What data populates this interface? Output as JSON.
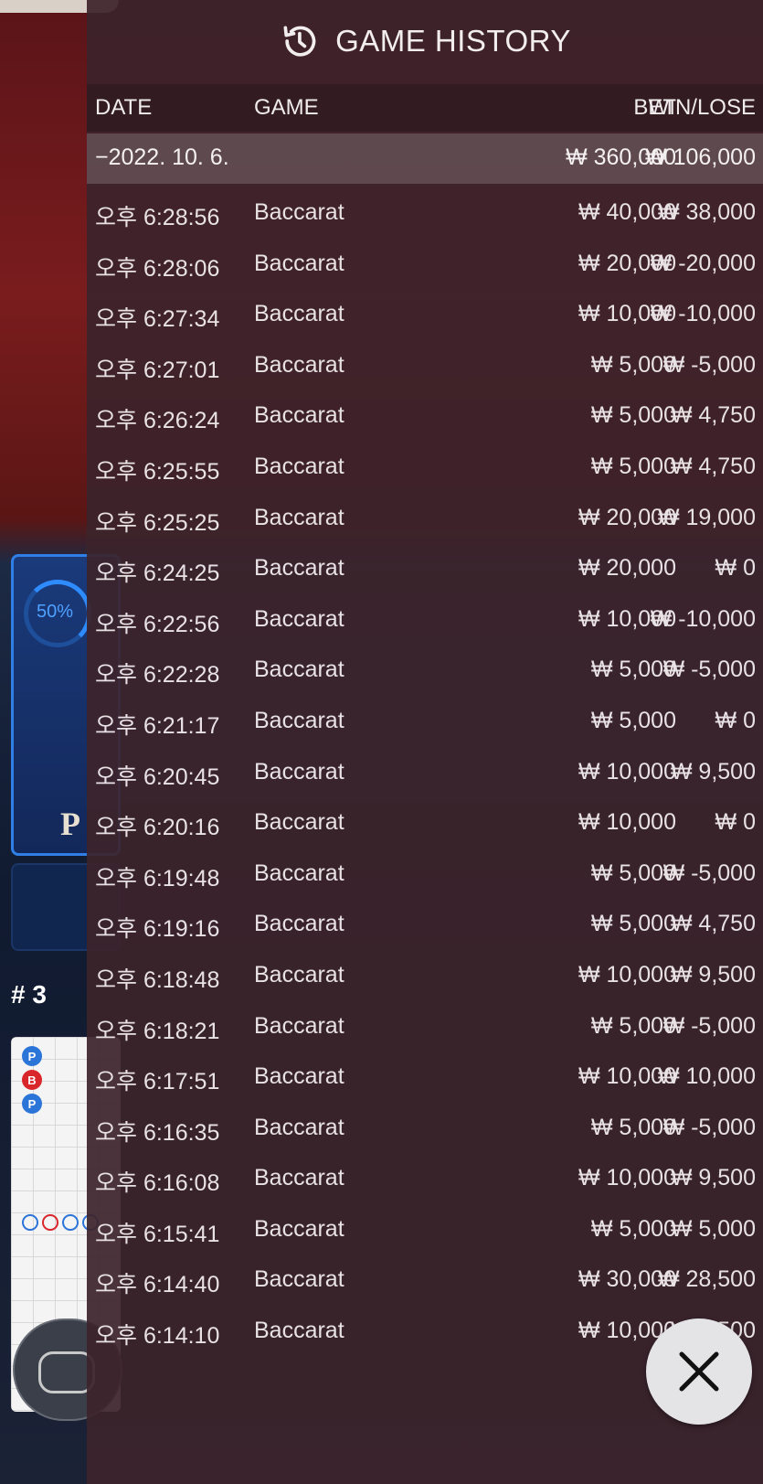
{
  "background": {
    "progress_label": "50%",
    "table_letter": "P",
    "table_number": "# 3",
    "beads": [
      "P",
      "B",
      "P"
    ]
  },
  "header": {
    "title": "GAME HISTORY",
    "icon": "history-icon"
  },
  "columns": {
    "date": "DATE",
    "game": "GAME",
    "bet": "BET",
    "win_lose": "WIN/LOSE"
  },
  "summary": {
    "date": "−2022. 10. 6.",
    "bet": "₩ 360,000",
    "win_lose": "₩ 106,000"
  },
  "rows": [
    {
      "time": "오후 6:28:56",
      "game": "Baccarat",
      "bet": "₩ 40,000",
      "win_lose": "₩ 38,000"
    },
    {
      "time": "오후 6:28:06",
      "game": "Baccarat",
      "bet": "₩ 20,000",
      "win_lose": "₩ -20,000"
    },
    {
      "time": "오후 6:27:34",
      "game": "Baccarat",
      "bet": "₩ 10,000",
      "win_lose": "₩ -10,000"
    },
    {
      "time": "오후 6:27:01",
      "game": "Baccarat",
      "bet": "₩ 5,000",
      "win_lose": "₩ -5,000"
    },
    {
      "time": "오후 6:26:24",
      "game": "Baccarat",
      "bet": "₩ 5,000",
      "win_lose": "₩ 4,750"
    },
    {
      "time": "오후 6:25:55",
      "game": "Baccarat",
      "bet": "₩ 5,000",
      "win_lose": "₩ 4,750"
    },
    {
      "time": "오후 6:25:25",
      "game": "Baccarat",
      "bet": "₩ 20,000",
      "win_lose": "₩ 19,000"
    },
    {
      "time": "오후 6:24:25",
      "game": "Baccarat",
      "bet": "₩ 20,000",
      "win_lose": "₩ 0"
    },
    {
      "time": "오후 6:22:56",
      "game": "Baccarat",
      "bet": "₩ 10,000",
      "win_lose": "₩ -10,000"
    },
    {
      "time": "오후 6:22:28",
      "game": "Baccarat",
      "bet": "₩ 5,000",
      "win_lose": "₩ -5,000"
    },
    {
      "time": "오후 6:21:17",
      "game": "Baccarat",
      "bet": "₩ 5,000",
      "win_lose": "₩ 0"
    },
    {
      "time": "오후 6:20:45",
      "game": "Baccarat",
      "bet": "₩ 10,000",
      "win_lose": "₩ 9,500"
    },
    {
      "time": "오후 6:20:16",
      "game": "Baccarat",
      "bet": "₩ 10,000",
      "win_lose": "₩ 0"
    },
    {
      "time": "오후 6:19:48",
      "game": "Baccarat",
      "bet": "₩ 5,000",
      "win_lose": "₩ -5,000"
    },
    {
      "time": "오후 6:19:16",
      "game": "Baccarat",
      "bet": "₩ 5,000",
      "win_lose": "₩ 4,750"
    },
    {
      "time": "오후 6:18:48",
      "game": "Baccarat",
      "bet": "₩ 10,000",
      "win_lose": "₩ 9,500"
    },
    {
      "time": "오후 6:18:21",
      "game": "Baccarat",
      "bet": "₩ 5,000",
      "win_lose": "₩ -5,000"
    },
    {
      "time": "오후 6:17:51",
      "game": "Baccarat",
      "bet": "₩ 10,000",
      "win_lose": "₩ 10,000"
    },
    {
      "time": "오후 6:16:35",
      "game": "Baccarat",
      "bet": "₩ 5,000",
      "win_lose": "₩ -5,000"
    },
    {
      "time": "오후 6:16:08",
      "game": "Baccarat",
      "bet": "₩ 10,000",
      "win_lose": "₩ 9,500"
    },
    {
      "time": "오후 6:15:41",
      "game": "Baccarat",
      "bet": "₩ 5,000",
      "win_lose": "₩ 5,000"
    },
    {
      "time": "오후 6:14:40",
      "game": "Baccarat",
      "bet": "₩ 30,000",
      "win_lose": "₩ 28,500"
    },
    {
      "time": "오후 6:14:10",
      "game": "Baccarat",
      "bet": "₩ 10,000",
      "win_lose": "₩ 9,500"
    }
  ],
  "close_button": {
    "icon": "close-icon"
  },
  "colors": {
    "panel_bg": "#3c242b",
    "summary_bg": "#78696e",
    "accent_blue": "#2f7fe6",
    "banker_red": "#d8262b",
    "player_blue": "#2b74d8"
  }
}
